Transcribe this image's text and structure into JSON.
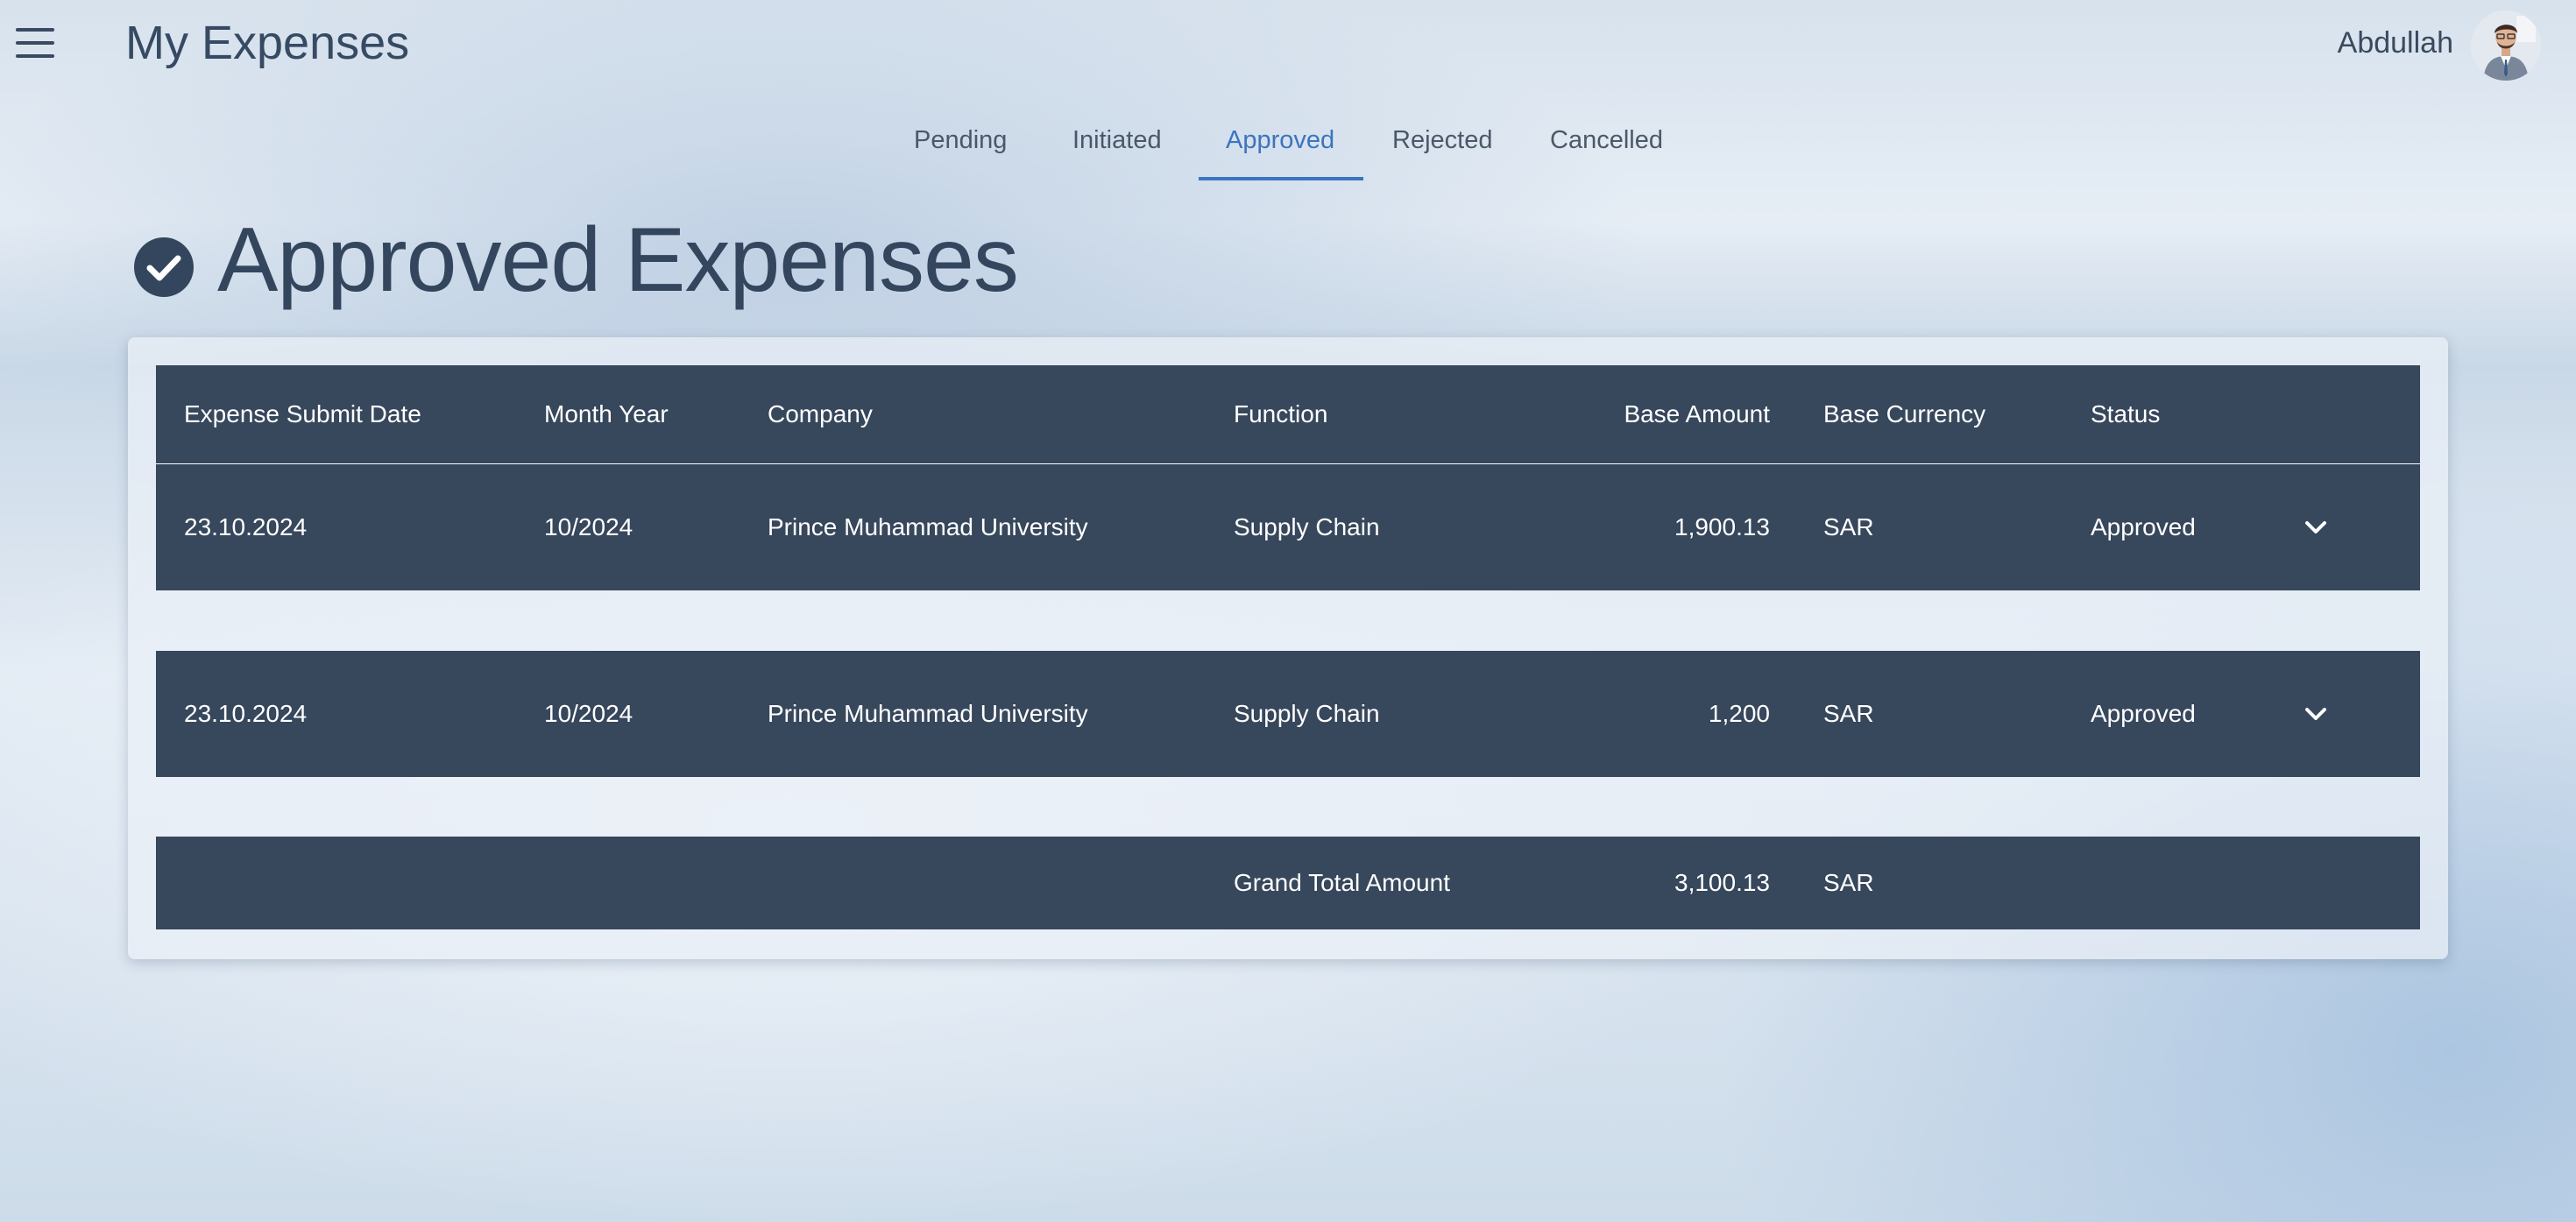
{
  "header": {
    "title": "My Expenses",
    "user_name": "Abdullah"
  },
  "tabs": [
    {
      "label": "Pending",
      "active": false
    },
    {
      "label": "Initiated",
      "active": false
    },
    {
      "label": "Approved",
      "active": true
    },
    {
      "label": "Rejected",
      "active": false
    },
    {
      "label": "Cancelled",
      "active": false
    }
  ],
  "section": {
    "title": "Approved Expenses",
    "icon": "check-circle-icon"
  },
  "table": {
    "columns": [
      "Expense Submit Date",
      "Month Year",
      "Company",
      "Function",
      "Base Amount",
      "Base Currency",
      "Status"
    ],
    "rows": [
      {
        "date": "23.10.2024",
        "month_year": "10/2024",
        "company": "Prince Muhammad University",
        "function": "Supply Chain",
        "base_amount": "1,900.13",
        "base_currency": "SAR",
        "status": "Approved"
      },
      {
        "date": "23.10.2024",
        "month_year": "10/2024",
        "company": "Prince Muhammad University",
        "function": "Supply Chain",
        "base_amount": "1,200",
        "base_currency": "SAR",
        "status": "Approved"
      }
    ],
    "total": {
      "label": "Grand Total Amount",
      "amount": "3,100.13",
      "currency": "SAR"
    }
  },
  "colors": {
    "accent": "#3c74bf",
    "table_bg": "#37475c",
    "title_text": "#34465d"
  }
}
